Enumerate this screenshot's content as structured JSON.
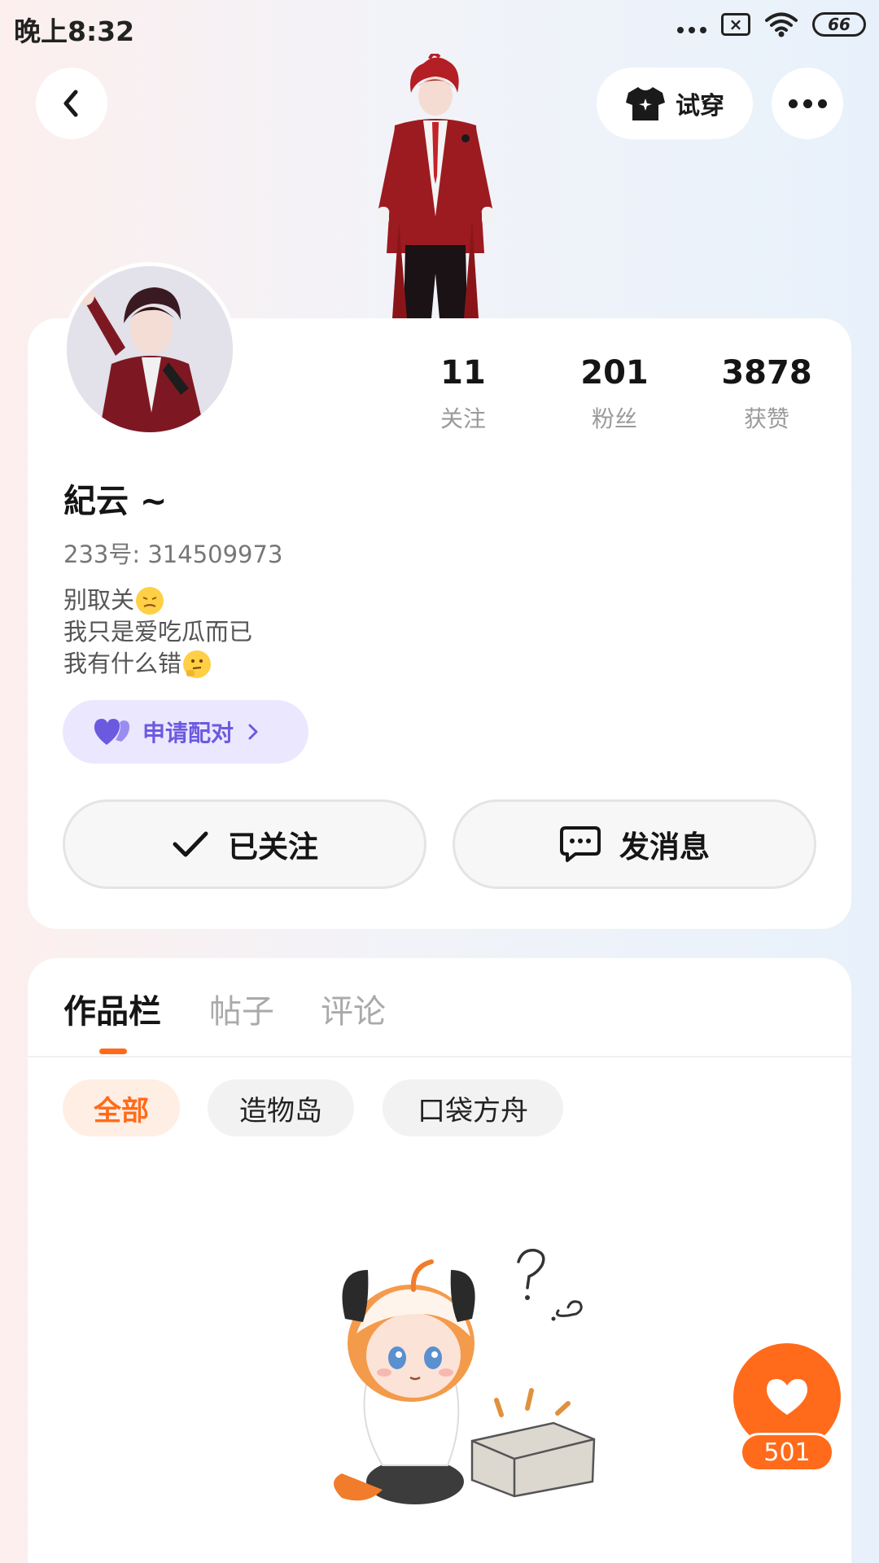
{
  "status_bar": {
    "time": "晚上8:32",
    "battery": "66",
    "icons": [
      "signal-dots-icon",
      "no-sim-icon",
      "wifi-icon",
      "battery-icon"
    ]
  },
  "nav": {
    "back_icon": "chevron-left-icon",
    "tryon_label": "试穿",
    "tryon_icon": "shirt-icon",
    "more_icon": "more-dots-icon"
  },
  "profile": {
    "stats": [
      {
        "value": "11",
        "label": "关注"
      },
      {
        "value": "201",
        "label": "粉丝"
      },
      {
        "value": "3878",
        "label": "获赞"
      }
    ],
    "name": "紀云 ~",
    "uid": "233号: 314509973",
    "bio_lines": [
      "别取关",
      "我只是爱吃瓜而已",
      "我有什么错"
    ],
    "pair_label": "申请配对",
    "follow_label": "已关注",
    "message_label": "发消息"
  },
  "tabs": [
    {
      "label": "作品栏",
      "active": true
    },
    {
      "label": "帖子",
      "active": false
    },
    {
      "label": "评论",
      "active": false
    }
  ],
  "filters": [
    {
      "label": "全部",
      "active": true
    },
    {
      "label": "造物岛",
      "active": false
    },
    {
      "label": "口袋方舟",
      "active": false
    }
  ],
  "like": {
    "count": "501"
  },
  "colors": {
    "accent": "#ff6b1a",
    "pair_purple": "#6b5ae0",
    "pair_bg": "#ebe7ff"
  }
}
